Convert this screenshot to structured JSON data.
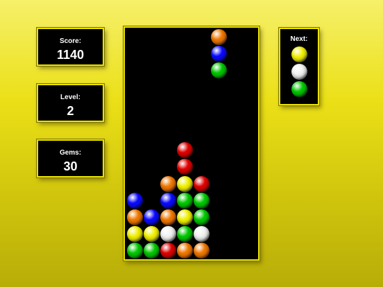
{
  "score": {
    "label": "Score:",
    "value": "1140"
  },
  "level": {
    "label": "Level:",
    "value": "2"
  },
  "gems": {
    "label": "Gems:",
    "value": "30"
  },
  "next": {
    "label": "Next:",
    "pieces": [
      "yellow",
      "white",
      "green"
    ]
  },
  "falling_piece": {
    "column": 5,
    "colors": [
      "orange",
      "blue",
      "green"
    ]
  },
  "board": {
    "columns": 8,
    "stacks": [
      [
        "green",
        "yellow",
        "orange",
        "blue"
      ],
      [
        "green",
        "yellow",
        "blue"
      ],
      [
        "red",
        "white",
        "orange",
        "blue",
        "orange"
      ],
      [
        "orange",
        "green",
        "yellow",
        "green",
        "yellow",
        "red",
        "red"
      ],
      [
        "orange",
        "white",
        "green",
        "green",
        "red"
      ],
      [],
      [],
      []
    ]
  },
  "colors": {
    "red": "#e00000",
    "green": "#00c800",
    "blue": "#0a0aff",
    "yellow": "#f0f000",
    "orange": "#f07800",
    "white": "#f0f0f0"
  }
}
